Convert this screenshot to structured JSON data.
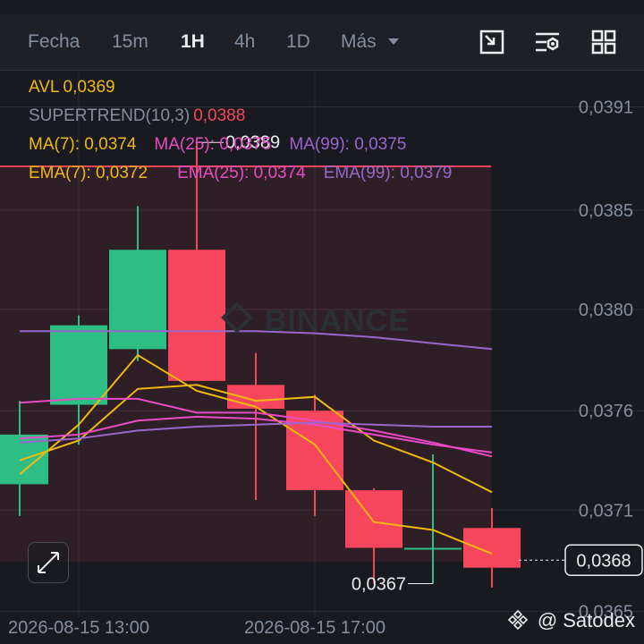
{
  "toolbar": {
    "tabs": [
      {
        "label": "Fecha",
        "active": false
      },
      {
        "label": "15m",
        "active": false
      },
      {
        "label": "1H",
        "active": true
      },
      {
        "label": "4h",
        "active": false
      },
      {
        "label": "1D",
        "active": false
      },
      {
        "label": "Más",
        "active": false
      }
    ],
    "icons": [
      "resize-icon",
      "indicator-settings-icon",
      "layout-grid-icon"
    ]
  },
  "legend": {
    "avl": {
      "label": "AVL",
      "value": "0,0369",
      "color": "#f0b90b"
    },
    "supertrend": {
      "label": "SUPERTREND(10,3)",
      "value": "0,0388",
      "color": "#f6465d"
    },
    "ma": [
      {
        "label": "MA(7): 0,0374",
        "color": "#f0b90b"
      },
      {
        "label": "MA(25): 0,0375",
        "color": "#e84bc3"
      },
      {
        "label": "MA(99): 0,0375",
        "color": "#9966cc"
      }
    ],
    "ema": [
      {
        "label": "EMA(7): 0,0372",
        "color": "#f0b90b"
      },
      {
        "label": "EMA(25): 0,0374",
        "color": "#e84bc3"
      },
      {
        "label": "EMA(99): 0,0379",
        "color": "#9966cc"
      }
    ]
  },
  "watermark": "BINANCE",
  "credit": "@ Satodex",
  "colors": {
    "up": "#2ebd85",
    "down": "#f6465d",
    "yellow": "#f0b90b",
    "pink": "#e84bc3",
    "purple": "#9966cc",
    "grid": "#2b2f36"
  },
  "chart_data": {
    "type": "candlestick",
    "interval": "1H",
    "x_tick_labels": [
      "2026-08-15 13:00",
      "2026-08-15 17:00"
    ],
    "y_tick_labels": [
      "0,0391",
      "0,0385",
      "0,0380",
      "0,0376",
      "0,0371",
      "0,0365"
    ],
    "ylim": [
      0.03645,
      0.03925
    ],
    "candles": [
      {
        "o": 0.0372,
        "h": 0.03762,
        "l": 0.03704,
        "c": 0.03745
      },
      {
        "o": 0.0376,
        "h": 0.03805,
        "l": 0.0374,
        "c": 0.038
      },
      {
        "o": 0.03788,
        "h": 0.0386,
        "l": 0.03782,
        "c": 0.03838
      },
      {
        "o": 0.03838,
        "h": 0.03892,
        "l": 0.03775,
        "c": 0.03772
      },
      {
        "o": 0.0377,
        "h": 0.03786,
        "l": 0.03712,
        "c": 0.03758
      },
      {
        "o": 0.03757,
        "h": 0.03765,
        "l": 0.03704,
        "c": 0.03717
      },
      {
        "o": 0.03717,
        "h": 0.03718,
        "l": 0.0367,
        "c": 0.03688
      },
      {
        "o": 0.03688,
        "h": 0.03735,
        "l": 0.0367,
        "c": 0.03688
      },
      {
        "o": 0.03698,
        "h": 0.03708,
        "l": 0.03668,
        "c": 0.03678
      }
    ],
    "series": [
      {
        "name": "MA(7)",
        "color": "#f0b90b",
        "values": [
          0.03725,
          0.0375,
          0.03785,
          0.03767,
          0.03759,
          0.0374,
          0.03701,
          0.03697,
          0.03685
        ]
      },
      {
        "name": "EMA(7)",
        "color": "#f0b90b",
        "values": [
          0.03732,
          0.03742,
          0.03768,
          0.0377,
          0.03762,
          0.03764,
          0.03742,
          0.03731,
          0.03716
        ]
      },
      {
        "name": "MA(25)",
        "color": "#e84bc3",
        "values": [
          0.03761,
          0.03763,
          0.03763,
          0.03756,
          0.03756,
          0.03752,
          0.03747,
          0.03741,
          0.03734
        ]
      },
      {
        "name": "EMA(25)",
        "color": "#e84bc3",
        "values": [
          0.03743,
          0.03745,
          0.03752,
          0.03754,
          0.03753,
          0.0375,
          0.03745,
          0.0374,
          0.03736
        ]
      },
      {
        "name": "MA(99)",
        "color": "#9966cc",
        "values": [
          0.03741,
          0.03743,
          0.03747,
          0.03749,
          0.0375,
          0.03751,
          0.0375,
          0.03749,
          0.03749
        ]
      },
      {
        "name": "EMA(99)",
        "color": "#9966cc",
        "values": [
          0.03797,
          0.03797,
          0.03797,
          0.03797,
          0.03797,
          0.03796,
          0.03794,
          0.03791,
          0.03788
        ]
      }
    ],
    "supertrend": {
      "value": 0.0388,
      "color": "#f6465d"
    },
    "annotations": {
      "high": "0,0389",
      "low": "0,0367",
      "last": "0,0368",
      "last_value": 0.0368
    }
  }
}
